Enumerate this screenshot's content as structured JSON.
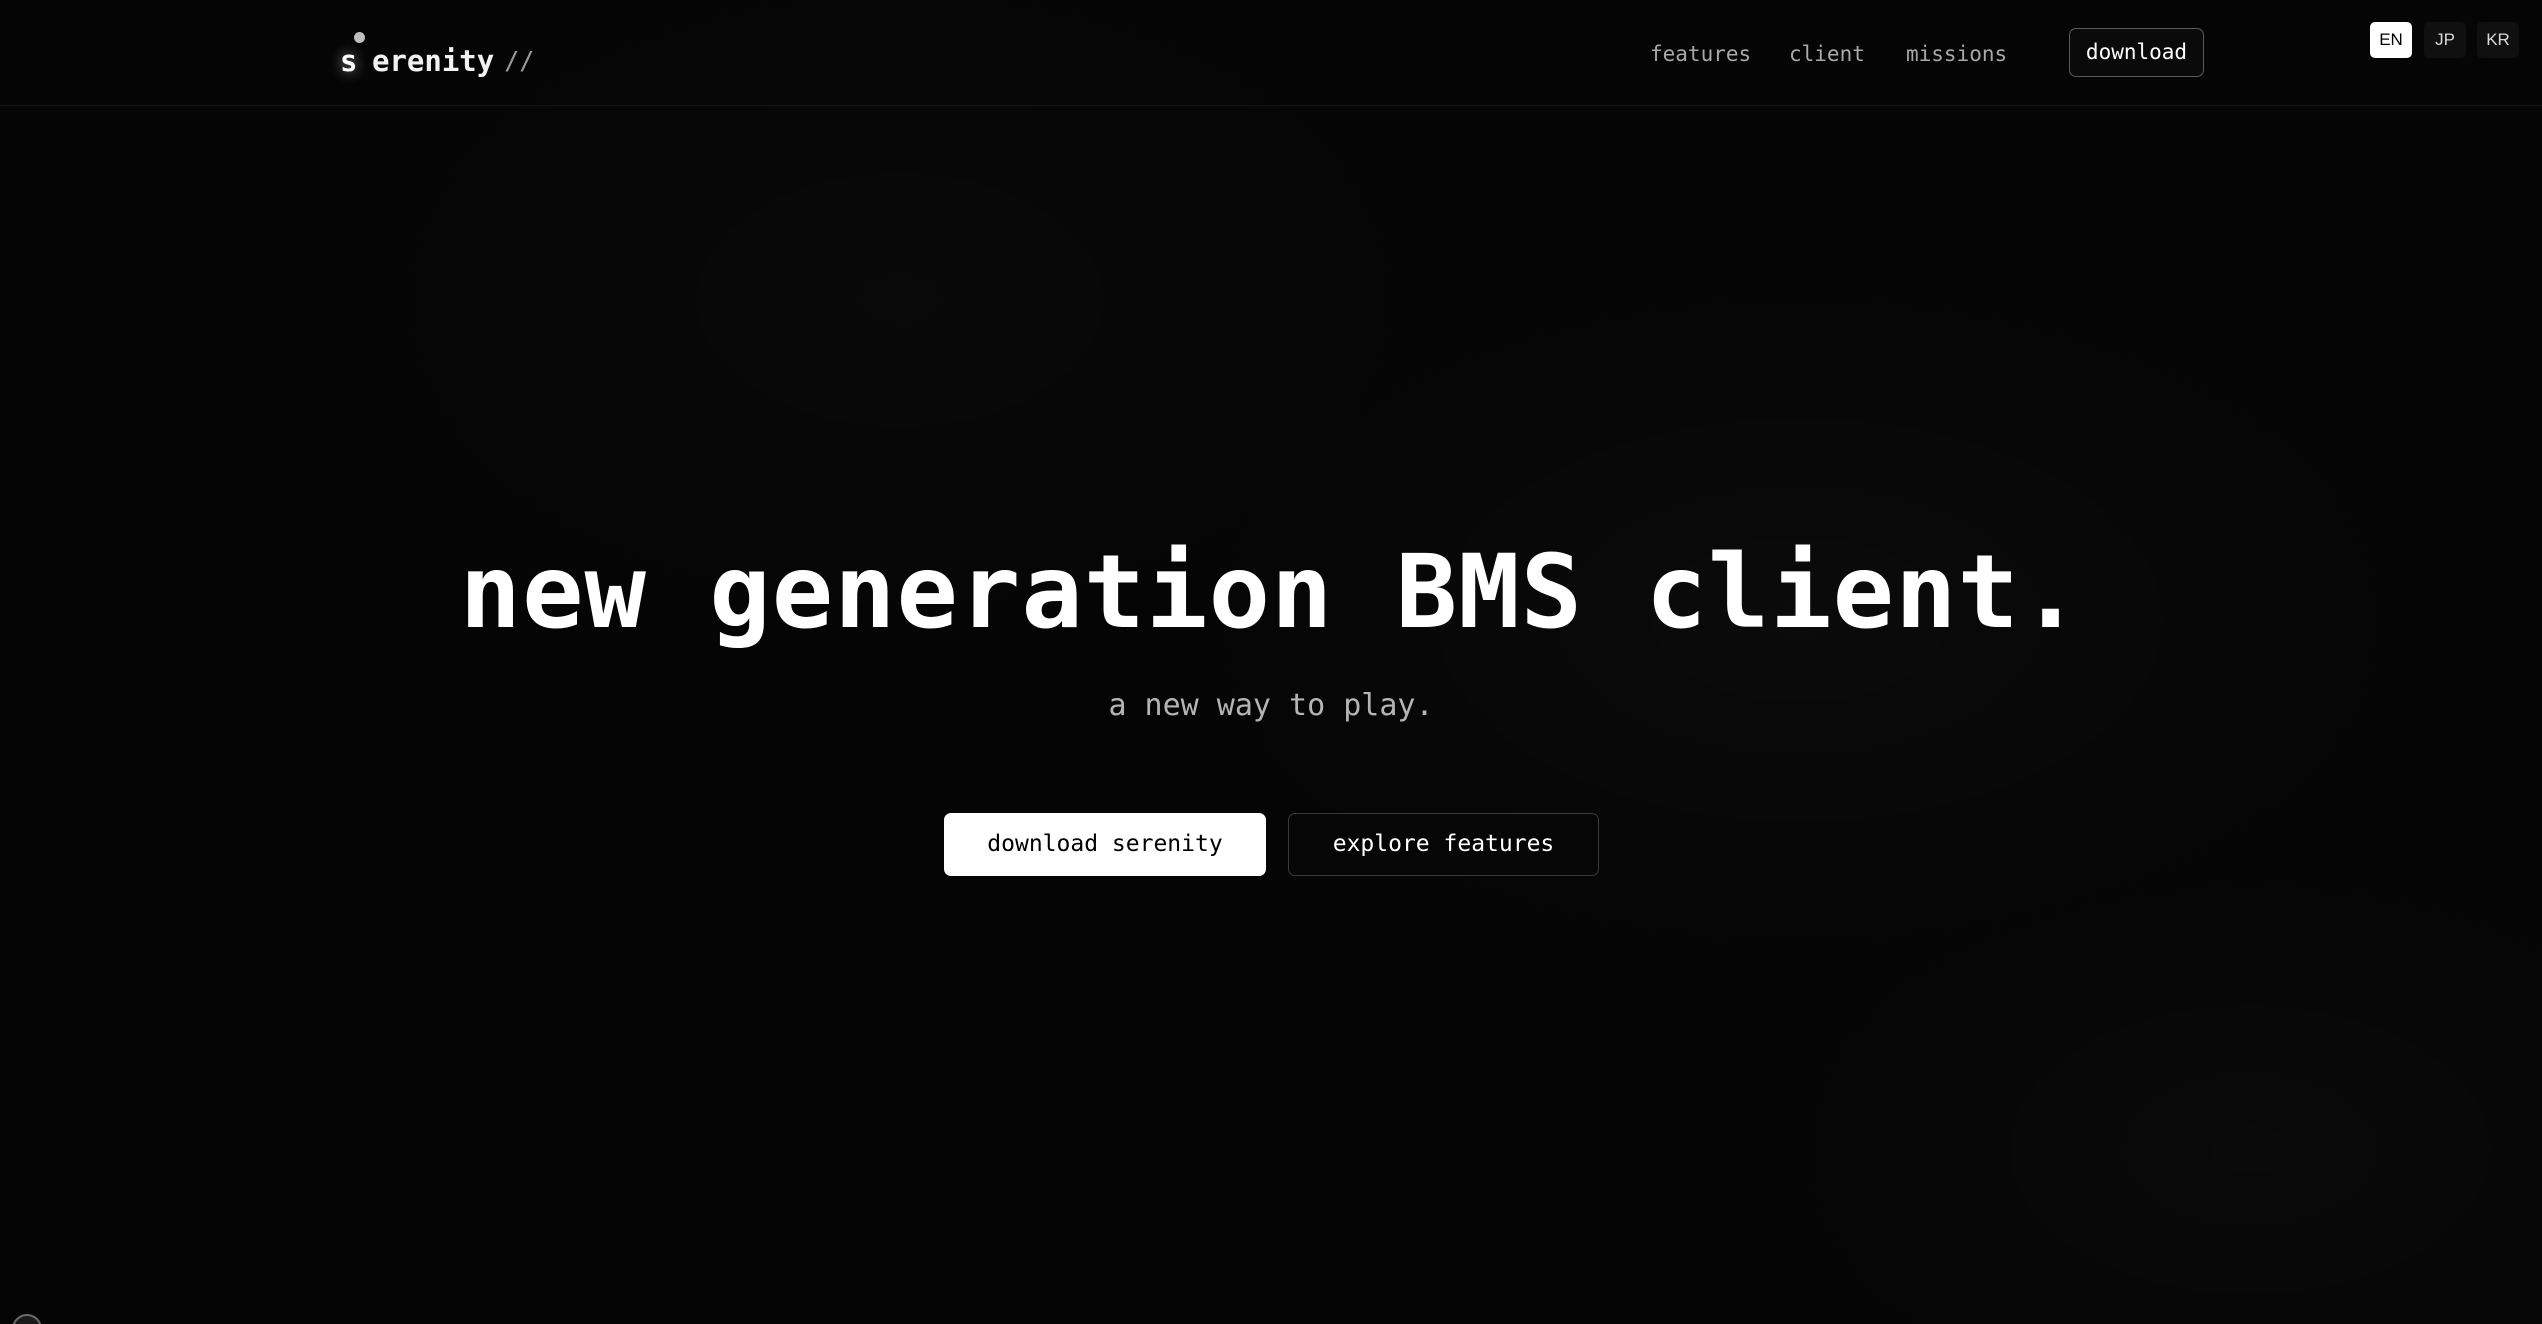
{
  "brand": {
    "logo_initial": "s",
    "logo_rest": "erenity",
    "logo_suffix": "//"
  },
  "nav": {
    "links": [
      {
        "label": "features"
      },
      {
        "label": "client"
      },
      {
        "label": "missions"
      }
    ],
    "download_label": "download"
  },
  "languages": {
    "active": "EN",
    "options": [
      "JP",
      "KR"
    ]
  },
  "hero": {
    "title": "new generation BMS client.",
    "subtitle": "a new way to play.",
    "primary_cta": "download serenity",
    "secondary_cta": "explore features"
  },
  "colors": {
    "background": "#050505",
    "text": "#ffffff",
    "muted": "#a8a8a8",
    "primary_button_bg": "#ffffff"
  }
}
